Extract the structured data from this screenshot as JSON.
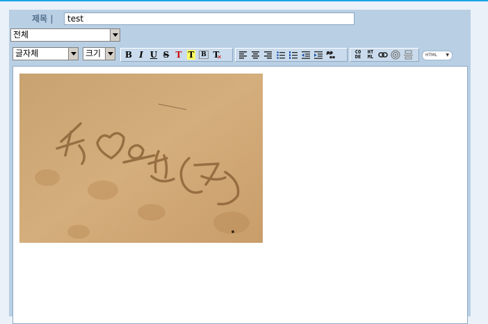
{
  "form": {
    "title_label": "제목 |",
    "title_value": "test",
    "category_selected": "전체"
  },
  "toolbar": {
    "font_select": "글자체",
    "size_select": "크기",
    "format_buttons": [
      {
        "label": "B",
        "icon": "bold-icon"
      },
      {
        "label": "I",
        "icon": "italic-icon"
      },
      {
        "label": "U",
        "icon": "underline-icon"
      },
      {
        "label": "S",
        "icon": "strikethrough-icon"
      },
      {
        "label": "T",
        "icon": "text-color-icon"
      },
      {
        "label": "T",
        "icon": "highlight-icon"
      },
      {
        "label": "B",
        "icon": "border-icon"
      },
      {
        "label": "T",
        "icon": "remove-format-icon"
      }
    ],
    "align_buttons": [
      {
        "icon": "align-left-icon"
      },
      {
        "icon": "align-center-icon"
      },
      {
        "icon": "align-right-icon"
      },
      {
        "icon": "bullet-list-icon"
      },
      {
        "icon": "numbered-list-icon"
      },
      {
        "icon": "outdent-icon"
      },
      {
        "icon": "indent-icon"
      },
      {
        "icon": "quote-icon"
      }
    ],
    "insert_buttons": [
      {
        "label_top": "CO",
        "label_bottom": "DE",
        "icon": "code-icon"
      },
      {
        "label_top": "HT",
        "label_bottom": "ML",
        "icon": "html-insert-icon"
      },
      {
        "icon": "link-icon"
      },
      {
        "icon": "target-icon"
      },
      {
        "icon": "divider-icon"
      }
    ],
    "html_mode": "HTML"
  },
  "colors": {
    "accent": "#1aa3e6",
    "panel": "#b9cfe4",
    "label": "#54708d",
    "text_red": "#cc0000",
    "highlight_yellow": "#ffff66"
  },
  "editor": {
    "image": "sand-writing-photo"
  }
}
